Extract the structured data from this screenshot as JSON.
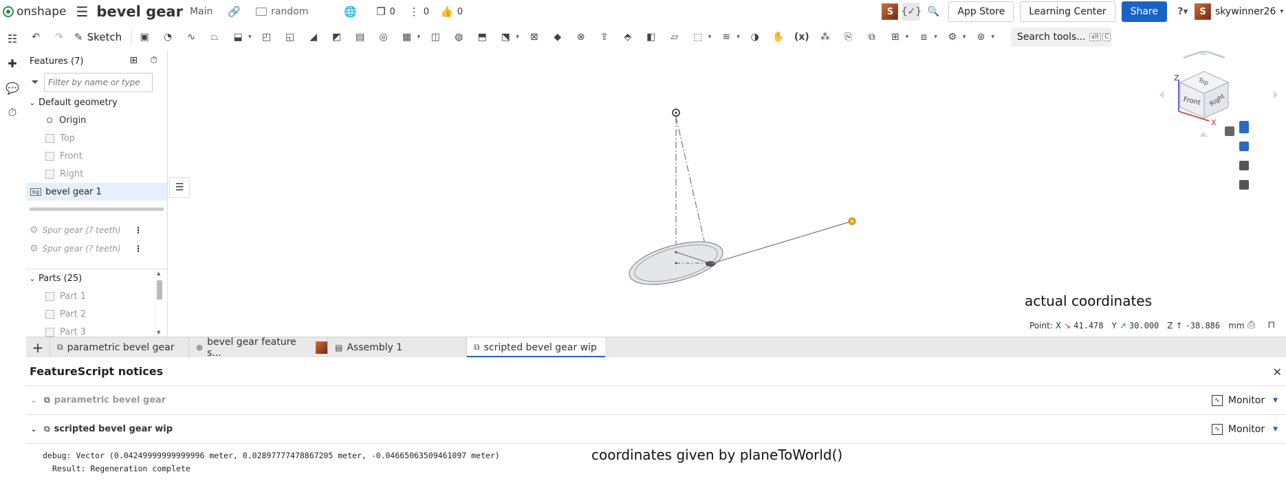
{
  "header": {
    "brand": "onshape",
    "doc_title": "bevel gear",
    "branch": "Main",
    "folder": "random",
    "stats": [
      {
        "icon": "versions-icon",
        "count": "0"
      },
      {
        "icon": "branch-icon",
        "count": "0"
      },
      {
        "icon": "like-icon",
        "count": "0"
      }
    ],
    "app_store": "App Store",
    "learning_center": "Learning Center",
    "share": "Share",
    "username": "skywinner26",
    "avatar_letter": "S"
  },
  "toolbar": {
    "sketch_label": "Sketch",
    "search_label": "Search tools...",
    "search_kbd1": "alt",
    "search_kbd2": "C"
  },
  "panel": {
    "features_label": "Features (7)",
    "filter_placeholder": "Filter by name or type",
    "default_geometry": "Default geometry",
    "origin": "Origin",
    "top": "Top",
    "front": "Front",
    "right": "Right",
    "bevel_gear_badge": "bg",
    "bevel_gear_feature": "bevel gear 1",
    "spur1": "Spur gear (? teeth)",
    "spur2": "Spur gear (? teeth)",
    "parts_label": "Parts (25)",
    "parts": [
      "Part 1",
      "Part 2",
      "Part 3"
    ]
  },
  "viewport": {
    "annotation_actual": "actual coordinates",
    "point_label": "Point:",
    "x_label": "X",
    "x_val": "41.478",
    "y_label": "Y",
    "y_val": "30.000",
    "z_label": "Z",
    "z_val": "-38.886",
    "unit": "mm",
    "cube_top": "Top",
    "cube_front": "Front",
    "cube_right": "Right",
    "axis_x": "X",
    "axis_z": "Z"
  },
  "tabs": [
    {
      "label": "parametric bevel gear"
    },
    {
      "label": "bevel gear feature s..."
    },
    {
      "label": "Assembly 1"
    },
    {
      "label": "scripted bevel gear wip"
    }
  ],
  "notices": {
    "title": "FeatureScript notices",
    "row1": "parametric bevel gear",
    "row2": "scripted bevel gear wip",
    "monitor": "Monitor",
    "debug_line": "debug: Vector (0.04249999999999996 meter, 0.02897777478867205 meter, -0.04665063509461097 meter)",
    "result_line": "Result: Regeneration complete",
    "annotation_planetoworld": "coordinates given by planeToWorld()"
  },
  "colors": {
    "share_blue": "#1a63c6",
    "onshape_green": "#2c8c4a",
    "point_orange": "#f2a81d"
  }
}
